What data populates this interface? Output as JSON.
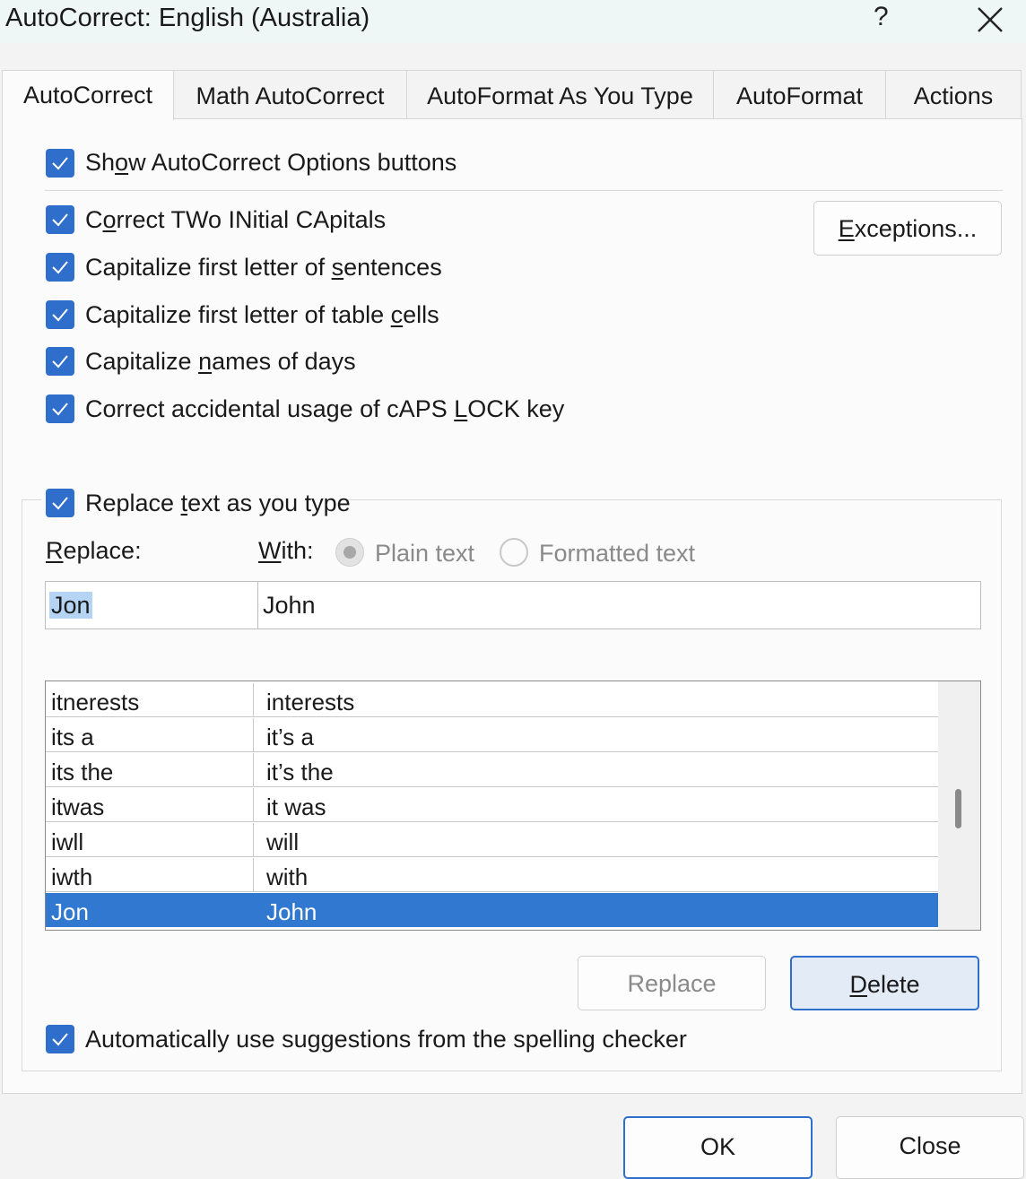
{
  "window": {
    "title": "AutoCorrect: English (Australia)",
    "help_label": "?"
  },
  "tabs": [
    {
      "label": "AutoCorrect",
      "active": true
    },
    {
      "label": "Math AutoCorrect"
    },
    {
      "label": "AutoFormat As You Type"
    },
    {
      "label": "AutoFormat"
    },
    {
      "label": "Actions"
    }
  ],
  "options": {
    "show_buttons": {
      "pre": "Sh",
      "ul": "o",
      "post": "w AutoCorrect Options buttons",
      "checked": true
    },
    "two_initial": {
      "pre": "C",
      "ul": "o",
      "post": "rrect TWo INitial CApitals",
      "checked": true
    },
    "first_sentence": {
      "pre": "Capitalize first letter of ",
      "ul": "s",
      "post": "entences",
      "checked": true
    },
    "first_table": {
      "pre": "Capitalize first letter of table ",
      "ul": "c",
      "post": "ells",
      "checked": true
    },
    "days": {
      "pre": "Capitalize ",
      "ul": "n",
      "post": "ames of days",
      "checked": true
    },
    "caps_lock": {
      "pre": "Correct accidental usage of cAPS ",
      "ul": "L",
      "post": "OCK key",
      "checked": true
    }
  },
  "exceptions_button": {
    "ul": "E",
    "post": "xceptions..."
  },
  "replace_group": {
    "replace_as_type": {
      "pre": "Replace ",
      "ul": "t",
      "post": "ext as you type",
      "checked": true
    },
    "replace_label": {
      "ul": "R",
      "post": "eplace:"
    },
    "with_label": {
      "ul": "W",
      "post": "ith:"
    },
    "plain_text": "Plain text",
    "formatted_text": "Formatted text",
    "replace_value": "Jon",
    "with_value": "John"
  },
  "entries": [
    {
      "from": "itnerests",
      "to": "interests"
    },
    {
      "from": "its a",
      "to": "it’s a"
    },
    {
      "from": "its the",
      "to": "it’s the"
    },
    {
      "from": "itwas",
      "to": "it was"
    },
    {
      "from": "iwll",
      "to": "will"
    },
    {
      "from": "iwth",
      "to": "with"
    },
    {
      "from": "Jon",
      "to": "John",
      "selected": true
    }
  ],
  "replace_button": "Replace",
  "delete_button": {
    "ul": "D",
    "post": "elete"
  },
  "spelling": {
    "pre": "Automatically use su",
    "ul": "g",
    "post": "gestions from the spelling checker",
    "checked": true
  },
  "ok_button": "OK",
  "close_button": "Close",
  "colors": {
    "accent": "#2f6ecb",
    "selection": "#3178d0",
    "title_bg": "#eef6f6"
  }
}
